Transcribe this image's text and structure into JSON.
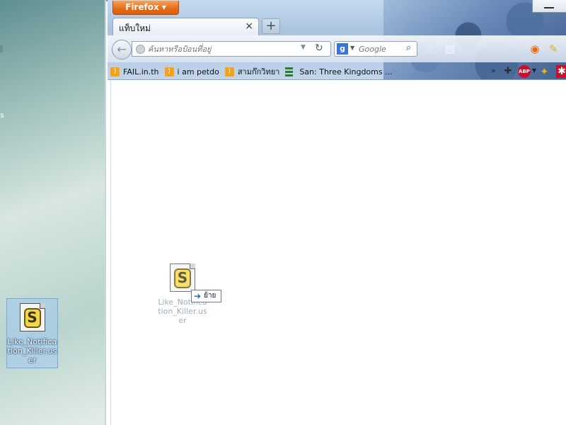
{
  "browser": {
    "menu_button": "Firefox",
    "tab_title": "แท็บใหม่",
    "tab_close": "×",
    "new_tab": "+",
    "url_placeholder": "ค้นหาหรือป้อนที่อยู่",
    "search_engine": "Google",
    "search_placeholder": "Google",
    "bookmarks": [
      {
        "label": "FAIL.in.th",
        "icon": "rss-icon"
      },
      {
        "label": "i am petdo",
        "icon": "rss-icon"
      },
      {
        "label": "สามก๊กวิทยา",
        "icon": "rss-icon"
      },
      {
        "label": "San: Three Kingdoms ...",
        "icon": "list-icon"
      }
    ],
    "bookmarks_overflow": "»",
    "addon_abp": "ABP"
  },
  "desktop": {
    "icon_label": "Like_Notification_Killer.user",
    "edge_text": "s"
  },
  "drag": {
    "label": "Like_Notification_Killer.user",
    "tooltip": "ย้าย"
  },
  "colors": {
    "firefox_orange": "#e26b15",
    "tab_active": "#fbfcfe",
    "selection": "#7aa8d6"
  }
}
